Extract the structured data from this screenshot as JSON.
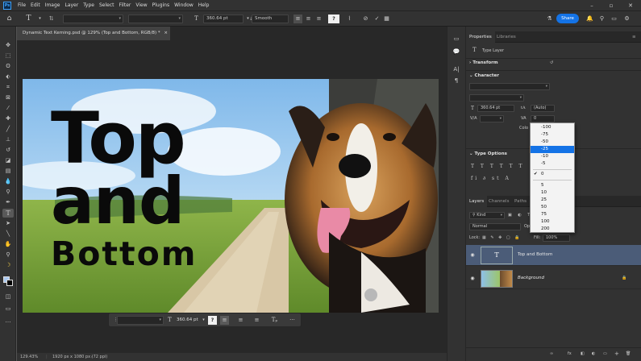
{
  "app": {
    "logo": "Ps"
  },
  "menubar": {
    "items": [
      "File",
      "Edit",
      "Image",
      "Layer",
      "Type",
      "Select",
      "Filter",
      "View",
      "Plugins",
      "Window",
      "Help"
    ],
    "window_controls": [
      "–",
      "▫",
      "✕"
    ]
  },
  "options": {
    "home_icon": "⌂",
    "type_tool_icon": "T",
    "font_size": "360.64 pt",
    "antialias": "Smooth",
    "share_label": "Share",
    "cancel_icon": "⊘",
    "commit_icon": "✓"
  },
  "document": {
    "tab_title": "Dynamic Text Kerning.psd @ 129% (Top and Bottom, RGB/8) *",
    "close": "×",
    "status": "129.43%",
    "dimensions": "1920 px x 1080 px (72 ppi)",
    "text_line1": "Top",
    "text_line2": "and",
    "text_line3": "Bottom"
  },
  "contextual_bar": {
    "font_size": "360.64 pt",
    "more": "···"
  },
  "properties": {
    "tabs": [
      "Properties",
      "Libraries"
    ],
    "layer_kind": "Type Layer",
    "transform_label": "Transform",
    "character_label": "Character",
    "size_value": "360.64 pt",
    "leading_value": "(Auto)",
    "tracking_value": "0",
    "color_label": "Colo",
    "type_options_label": "Type Options"
  },
  "kerning_menu": {
    "items": [
      "-100",
      "-75",
      "-50",
      "-25",
      "-10",
      "-5",
      "0",
      "5",
      "10",
      "25",
      "50",
      "75",
      "100",
      "200"
    ],
    "highlighted": "-25",
    "checked": "0"
  },
  "layers": {
    "tabs": [
      "Layers",
      "Channels",
      "Paths"
    ],
    "filter_kind": "Kind",
    "blend_mode": "Normal",
    "opacity_label": "Op",
    "lock_label": "Lock:",
    "fill_label": "Fill:",
    "fill_value": "100%",
    "rows": [
      {
        "name": "Top and Bottom",
        "thumb": "T"
      },
      {
        "name": "Background"
      }
    ],
    "footer_icons": [
      "∞",
      "fx",
      "◧",
      "◐",
      "▭",
      "+",
      "🗑"
    ]
  },
  "colors": {
    "accent": "#1473e6",
    "panel_bg": "#323232",
    "canvas_bg": "#282828",
    "selected_layer": "#4b5c78",
    "text_black": "#0a0a0a"
  }
}
